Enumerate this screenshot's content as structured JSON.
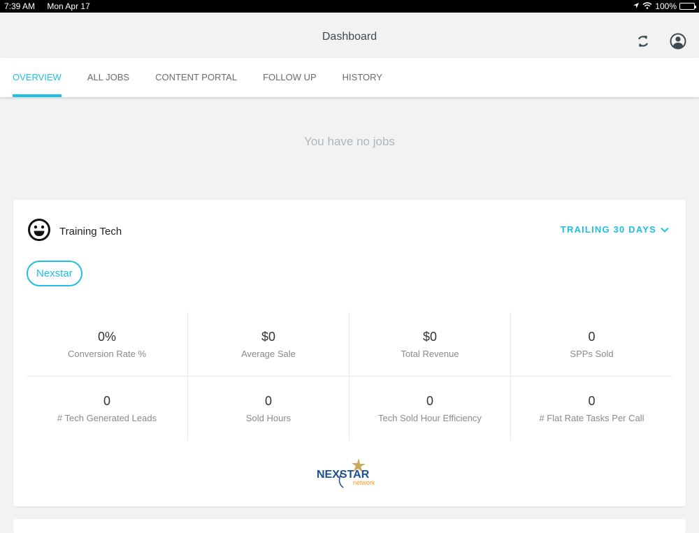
{
  "status_bar": {
    "time": "7:39 AM",
    "date": "Mon Apr 17",
    "battery": "100%"
  },
  "header": {
    "title": "Dashboard",
    "icons": [
      "refresh-icon",
      "profile-icon"
    ]
  },
  "tabs": [
    {
      "label": "OVERVIEW",
      "active": true
    },
    {
      "label": "ALL JOBS",
      "active": false
    },
    {
      "label": "CONTENT PORTAL",
      "active": false
    },
    {
      "label": "FOLLOW UP",
      "active": false
    },
    {
      "label": "HISTORY",
      "active": false
    }
  ],
  "jobs": {
    "empty_message": "You have no jobs"
  },
  "tech_card": {
    "name": "Training Tech",
    "period": "TRAILING 30 DAYS",
    "chip": "Nexstar",
    "metrics": [
      {
        "value": "0%",
        "label": "Conversion Rate %"
      },
      {
        "value": "$0",
        "label": "Average Sale"
      },
      {
        "value": "$0",
        "label": "Total Revenue"
      },
      {
        "value": "0",
        "label": "SPPs Sold"
      },
      {
        "value": "0",
        "label": "# Tech Generated Leads"
      },
      {
        "value": "0",
        "label": "Sold Hours"
      },
      {
        "value": "0",
        "label": "Tech Sold Hour Efficiency"
      },
      {
        "value": "0",
        "label": "# Flat Rate Tasks Per Call"
      }
    ],
    "logo": {
      "main": "NEXSTAR",
      "sub": "network"
    }
  },
  "colors": {
    "accent": "#1ebfe6",
    "logo_blue": "#1d4f91",
    "logo_orange": "#f39a1e",
    "logo_gold": "#c9a85a"
  }
}
